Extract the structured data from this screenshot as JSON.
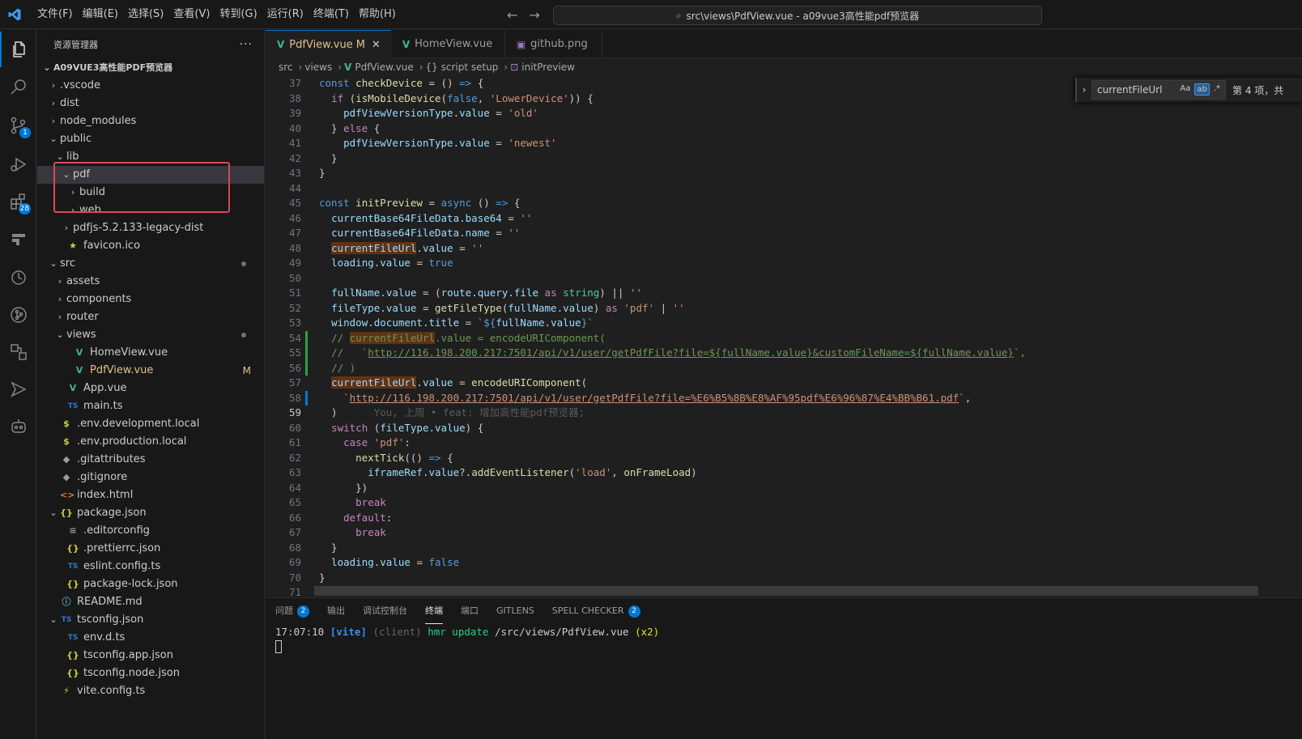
{
  "menu": [
    "文件(F)",
    "编辑(E)",
    "选择(S)",
    "查看(V)",
    "转到(G)",
    "运行(R)",
    "终端(T)",
    "帮助(H)"
  ],
  "command_center": "src\\views\\PdfView.vue - a09vue3高性能pdf预览器",
  "activity": {
    "source_control_badge": "1",
    "extensions_badge": "28"
  },
  "sidebar": {
    "title": "资源管理器",
    "more": "···",
    "root": "A09VUE3高性能PDF预览器",
    "items": [
      {
        "label": ".vscode",
        "chev": "›",
        "icon": "",
        "depth": 1
      },
      {
        "label": "dist",
        "chev": "›",
        "icon": "",
        "depth": 1
      },
      {
        "label": "node_modules",
        "chev": "›",
        "icon": "",
        "depth": 1
      },
      {
        "label": "public",
        "chev": "⌄",
        "icon": "",
        "depth": 1
      },
      {
        "label": "lib",
        "chev": "⌄",
        "icon": "",
        "depth": 2
      },
      {
        "label": "pdf",
        "chev": "⌄",
        "icon": "",
        "depth": 3
      },
      {
        "label": "build",
        "chev": "›",
        "icon": "",
        "depth": 4
      },
      {
        "label": "web",
        "chev": "›",
        "icon": "",
        "depth": 4
      },
      {
        "label": "pdfjs-5.2.133-legacy-dist",
        "chev": "›",
        "icon": "",
        "depth": 3
      },
      {
        "label": "favicon.ico",
        "chev": "",
        "icon": "★",
        "depth": 2
      },
      {
        "label": "src",
        "chev": "⌄",
        "icon": "",
        "depth": 1
      },
      {
        "label": "assets",
        "chev": "›",
        "icon": "",
        "depth": 2
      },
      {
        "label": "components",
        "chev": "›",
        "icon": "",
        "depth": 2
      },
      {
        "label": "router",
        "chev": "›",
        "icon": "",
        "depth": 2
      },
      {
        "label": "views",
        "chev": "⌄",
        "icon": "",
        "depth": 2
      },
      {
        "label": "HomeView.vue",
        "chev": "",
        "icon": "V",
        "depth": 3
      },
      {
        "label": "PdfView.vue",
        "chev": "",
        "icon": "V",
        "depth": 3
      },
      {
        "label": "App.vue",
        "chev": "",
        "icon": "V",
        "depth": 2
      },
      {
        "label": "main.ts",
        "chev": "",
        "icon": "TS",
        "depth": 2
      },
      {
        "label": ".env.development.local",
        "chev": "",
        "icon": "$",
        "depth": 1
      },
      {
        "label": ".env.production.local",
        "chev": "",
        "icon": "$",
        "depth": 1
      },
      {
        "label": ".gitattributes",
        "chev": "",
        "icon": "◆",
        "depth": 1
      },
      {
        "label": ".gitignore",
        "chev": "",
        "icon": "◆",
        "depth": 1
      },
      {
        "label": "index.html",
        "chev": "",
        "icon": "<>",
        "depth": 1
      },
      {
        "label": "package.json",
        "chev": "⌄",
        "icon": "{}",
        "depth": 1
      },
      {
        "label": ".editorconfig",
        "chev": "",
        "icon": "≡",
        "depth": 2
      },
      {
        "label": ".prettierrc.json",
        "chev": "",
        "icon": "{}",
        "depth": 2
      },
      {
        "label": "eslint.config.ts",
        "chev": "",
        "icon": "TS",
        "depth": 2
      },
      {
        "label": "package-lock.json",
        "chev": "",
        "icon": "{}",
        "depth": 2
      },
      {
        "label": "README.md",
        "chev": "",
        "icon": "ⓘ",
        "depth": 1
      },
      {
        "label": "tsconfig.json",
        "chev": "⌄",
        "icon": "TS",
        "depth": 1
      },
      {
        "label": "env.d.ts",
        "chev": "",
        "icon": "TS",
        "depth": 2
      },
      {
        "label": "tsconfig.app.json",
        "chev": "",
        "icon": "{}",
        "depth": 2
      },
      {
        "label": "tsconfig.node.json",
        "chev": "",
        "icon": "{}",
        "depth": 2
      },
      {
        "label": "vite.config.ts",
        "chev": "",
        "icon": "⚡",
        "depth": 1
      }
    ],
    "modified_marker": "M"
  },
  "tabs": [
    {
      "label": "PdfView.vue",
      "icon": "V",
      "modified": "M",
      "close": "✕"
    },
    {
      "label": "HomeView.vue",
      "icon": "V"
    },
    {
      "label": "github.png",
      "icon": "▣"
    }
  ],
  "breadcrumb": [
    "src",
    "views",
    "PdfView.vue",
    "{} script setup",
    "initPreview"
  ],
  "find": {
    "query": "currentFileUrl",
    "opt_case": "Aa",
    "opt_word": "ab",
    "opt_regex": ".*",
    "count": "第 4 项，共"
  },
  "code_lines": [
    {
      "n": "37",
      "html": "<span class='kw'>const</span> <span class='fn'>checkDevice</span> = () <span class='kw'>=&gt;</span> {"
    },
    {
      "n": "38",
      "html": "  <span class='kw2'>if</span> (<span class='fn'>isMobileDevice</span>(<span class='kw'>false</span>, <span class='str'>'LowerDevice'</span>)) {"
    },
    {
      "n": "39",
      "html": "    <span class='var'>pdfViewVersionType</span>.<span class='var'>value</span> = <span class='str'>'old'</span>"
    },
    {
      "n": "40",
      "html": "  } <span class='kw2'>else</span> {"
    },
    {
      "n": "41",
      "html": "    <span class='var'>pdfViewVersionType</span>.<span class='var'>value</span> = <span class='str'>'newest'</span>"
    },
    {
      "n": "42",
      "html": "  }"
    },
    {
      "n": "43",
      "html": "}"
    },
    {
      "n": "44",
      "html": ""
    },
    {
      "n": "45",
      "html": "<span class='kw'>const</span> <span class='fn'>initPreview</span> = <span class='kw'>async</span> () <span class='kw'>=&gt;</span> {"
    },
    {
      "n": "46",
      "html": "  <span class='var'>currentBase64FileData</span>.<span class='var'>base64</span> = <span class='str'>''</span>"
    },
    {
      "n": "47",
      "html": "  <span class='var'>currentBase64FileData</span>.<span class='var'>name</span> = <span class='str'>''</span>"
    },
    {
      "n": "48",
      "html": "  <span class='var match'>currentFileUrl</span>.<span class='var'>value</span> = <span class='str'>''</span>"
    },
    {
      "n": "49",
      "html": "  <span class='var'>loading</span>.<span class='var'>value</span> = <span class='kw'>true</span>"
    },
    {
      "n": "50",
      "html": ""
    },
    {
      "n": "51",
      "html": "  <span class='var'>fullName</span>.<span class='var'>value</span> = (<span class='var'>route</span>.<span class='var'>query</span>.<span class='var'>file</span> <span class='kw2'>as</span> <span class='ty'>string</span>) || <span class='str'>''</span>"
    },
    {
      "n": "52",
      "html": "  <span class='var'>fileType</span>.<span class='var'>value</span> = <span class='fn'>getFileType</span>(<span class='var'>fullName</span>.<span class='var'>value</span>) <span class='kw2'>as</span> <span class='str'>'pdf'</span> | <span class='str'>''</span>"
    },
    {
      "n": "53",
      "html": "  <span class='var'>window</span>.<span class='var'>document</span>.<span class='var'>title</span> = <span class='str'>`</span><span class='kw'>${</span><span class='var'>fullName</span>.<span class='var'>value</span><span class='kw'>}</span><span class='str'>`</span>"
    },
    {
      "n": "54",
      "html": "  <span class='cm'>// </span><span class='cm match-cm'>currentFileUrl</span><span class='cm'>.value = encodeURIComponent(</span>",
      "git": "add"
    },
    {
      "n": "55",
      "html": "  <span class='cm'>//   `</span><span class='cm-url'>http://116.198.200.217:7501/api/v1/user/getPdfFile?file=${fullName.value}&amp;customFileName=${fullName.value}</span><span class='cm'>`,</span>",
      "git": "add"
    },
    {
      "n": "56",
      "html": "  <span class='cm'>// )</span>",
      "git": "add"
    },
    {
      "n": "57",
      "html": "  <span class='var match'>currentFileUrl</span>.<span class='var'>value</span> = <span class='fn'>encodeURIComponent</span>("
    },
    {
      "n": "58",
      "html": "    <span class='str'>`</span><span class='url'>http://116.198.200.217:7501/api/v1/user/getPdfFile?file=%E6%B5%8B%E8%AF%95pdf%E6%96%87%E4%BB%B61.pdf</span><span class='str'>`</span>,",
      "git": "mod"
    },
    {
      "n": "59",
      "html": "  )      <span class='blame'>You, 上周 • feat: 增加高性能pdf预览器;</span>",
      "current": true
    },
    {
      "n": "60",
      "html": "  <span class='kw2'>switch</span> (<span class='var'>fileType</span>.<span class='var'>value</span>) {"
    },
    {
      "n": "61",
      "html": "    <span class='kw2'>case</span> <span class='str'>'pdf'</span>:"
    },
    {
      "n": "62",
      "html": "      <span class='fn'>nextTick</span>(() <span class='kw'>=&gt;</span> {"
    },
    {
      "n": "63",
      "html": "        <span class='var'>iframeRef</span>.<span class='var'>value</span>?.<span class='fn'>addEventListener</span>(<span class='str'>'load'</span>, <span class='fn'>onFrameLoad</span>)"
    },
    {
      "n": "64",
      "html": "      })"
    },
    {
      "n": "65",
      "html": "      <span class='kw2'>break</span>"
    },
    {
      "n": "66",
      "html": "    <span class='kw2'>default</span>:"
    },
    {
      "n": "67",
      "html": "      <span class='kw2'>break</span>"
    },
    {
      "n": "68",
      "html": "  }"
    },
    {
      "n": "69",
      "html": "  <span class='var'>loading</span>.<span class='var'>value</span> = <span class='kw'>false</span>"
    },
    {
      "n": "70",
      "html": "}"
    },
    {
      "n": "71",
      "html": ""
    }
  ],
  "panel": {
    "tabs": [
      {
        "label": "问题",
        "badge": "2"
      },
      {
        "label": "输出"
      },
      {
        "label": "调试控制台"
      },
      {
        "label": "终端",
        "active": true
      },
      {
        "label": "端口"
      },
      {
        "label": "GITLENS"
      },
      {
        "label": "SPELL CHECKER",
        "badge": "2"
      }
    ],
    "terminal": {
      "time": "17:07:10",
      "vite": "[vite]",
      "client": "(client)",
      "hmr": "hmr update",
      "path": "/src/views/PdfView.vue",
      "count": "(x2)"
    }
  }
}
